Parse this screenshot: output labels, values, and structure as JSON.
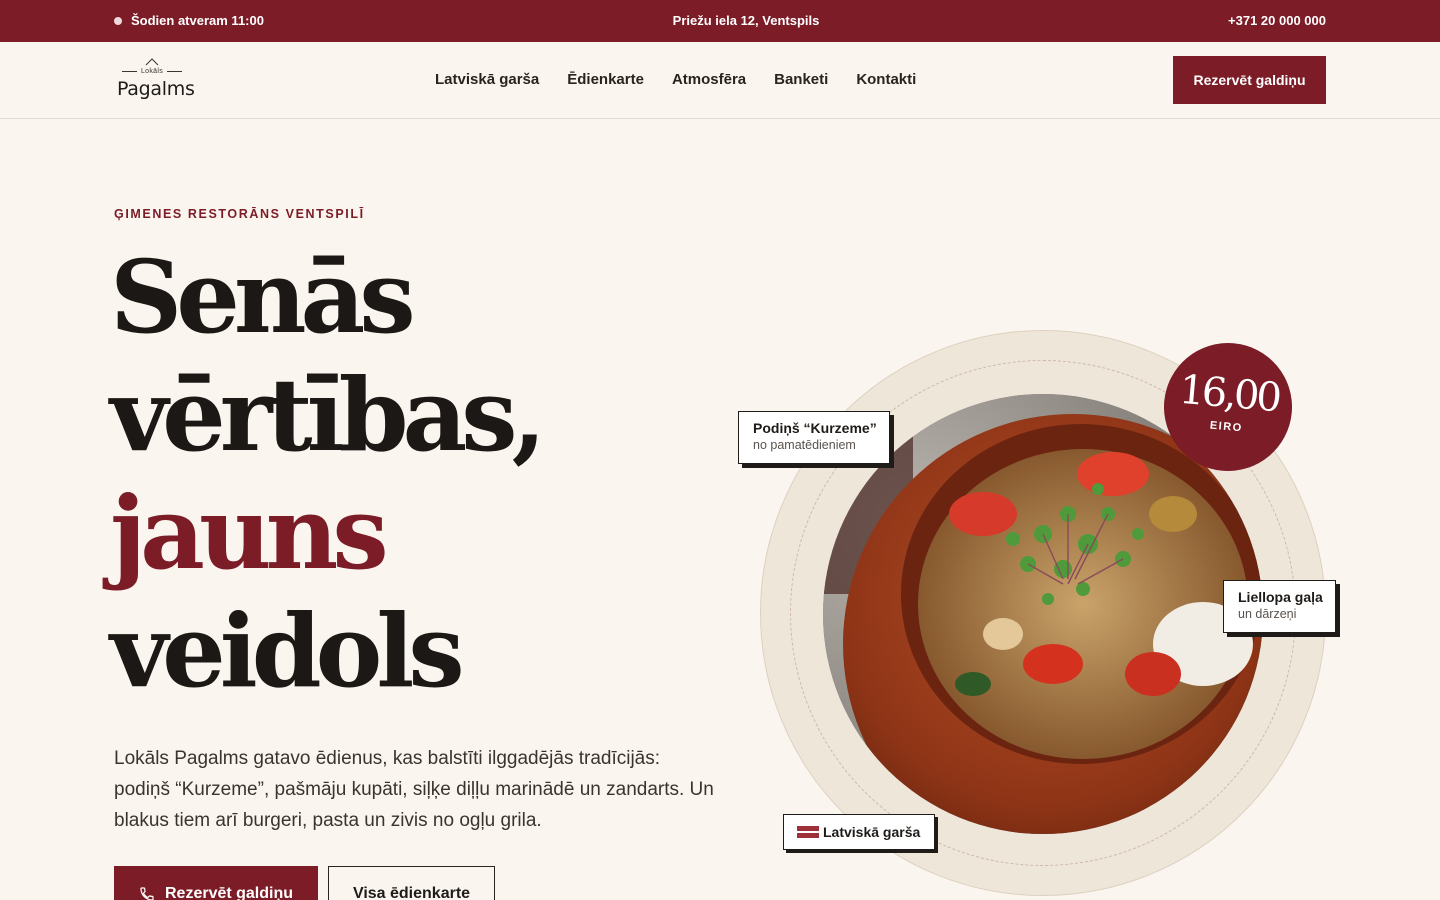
{
  "topbar": {
    "open_text": "Šodien atveram 11:00",
    "address": "Priežu iela 12, Ventspils",
    "phone": "+371 20 000 000"
  },
  "header": {
    "logo_small": "Lokāls",
    "logo_big": "Pagalms",
    "nav": [
      {
        "label": "Latviskā garša"
      },
      {
        "label": "Ēdienkarte"
      },
      {
        "label": "Atmosfēra"
      },
      {
        "label": "Banketi"
      },
      {
        "label": "Kontakti"
      }
    ],
    "reserve_label": "Rezervēt galdiņu"
  },
  "hero": {
    "eyebrow": "ĢIMENES RESTORĀNS VENTSPILĪ",
    "headline": [
      "Senās",
      "vērtības,",
      "jauns",
      "veidols"
    ],
    "lead": "Lokāls Pagalms gatavo ēdienus, kas balstīti ilggadējās tradīcijās: podiņš “Kurzeme”, pašmāju kupāti, siļķe diļļu marinādē un zandarts. Un blakus tiem arī burgeri, pasta un zivis no ogļu grila.",
    "cta_primary": "Rezervēt galdiņu",
    "cta_secondary": "Visa ēdienkarte"
  },
  "dish": {
    "price_amount": "16,00",
    "price_unit": "EIRO",
    "card_1_title": "Podiņš “Kurzeme”",
    "card_1_sub": "no pamatēdieniem",
    "card_2_title": "Liellopa gaļa",
    "card_2_sub": "un dārzeņi",
    "tag": "Latviskā garša"
  },
  "colors": {
    "brand": "#7b1c27",
    "background": "#faf6ef",
    "text": "#1f1b18"
  }
}
